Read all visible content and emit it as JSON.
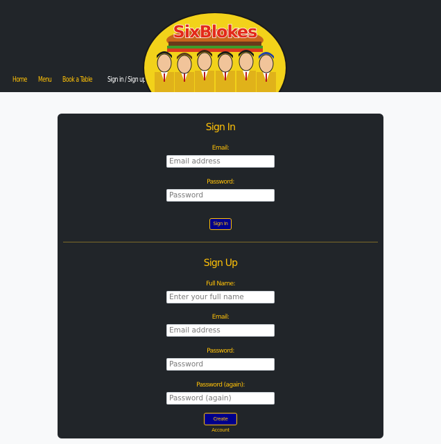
{
  "nav": {
    "items": [
      {
        "label": "Home"
      },
      {
        "label": "Menu"
      },
      {
        "label": "Book a Table"
      },
      {
        "label": "Sign in / Sign up"
      }
    ]
  },
  "logo": {
    "text": "SixBlokes"
  },
  "signin": {
    "title": "Sign In",
    "email_label": "Email:",
    "email_placeholder": "Email address",
    "password_label": "Password:",
    "password_placeholder": "Password",
    "button_label": "Sign In"
  },
  "signup": {
    "title": "Sign Up",
    "fullname_label": "Full Name:",
    "fullname_placeholder": "Enter your full name",
    "email_label": "Email:",
    "email_placeholder": "Email address",
    "password_label": "Password:",
    "password_placeholder": "Password",
    "password2_label": "Password (again):",
    "password2_placeholder": "Password (again)",
    "button_label": "Create Account"
  },
  "colors": {
    "dark": "#212529",
    "accent": "#ffc107",
    "button_bg": "#00008b",
    "page_bg": "#f8f9fa"
  }
}
